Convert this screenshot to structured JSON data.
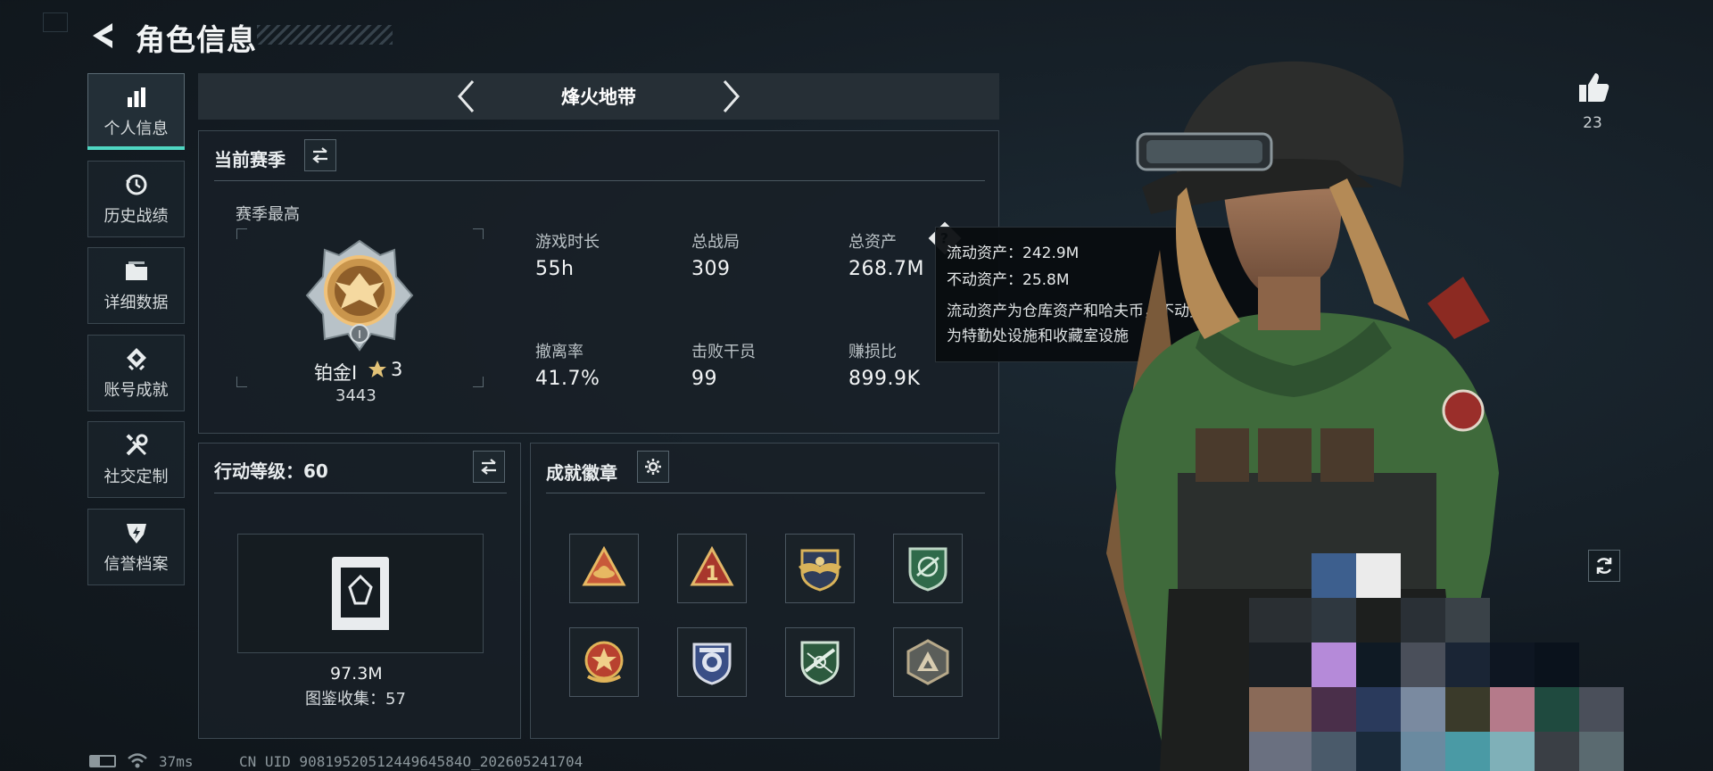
{
  "header": {
    "title": "角色信息"
  },
  "sidebar": {
    "items": [
      {
        "label": "个人信息",
        "icon": "bar-chart-icon",
        "active": true
      },
      {
        "label": "历史战绩",
        "icon": "clock-history-icon",
        "active": false
      },
      {
        "label": "详细数据",
        "icon": "folder-icon",
        "active": false
      },
      {
        "label": "账号成就",
        "icon": "medal-icon",
        "active": false
      },
      {
        "label": "社交定制",
        "icon": "tools-icon",
        "active": false
      },
      {
        "label": "信誉档案",
        "icon": "shield-icon",
        "active": false
      }
    ]
  },
  "season": {
    "name": "烽火地带"
  },
  "current_season": {
    "title": "当前赛季",
    "highest_label": "赛季最高",
    "rank_name": "铂金I",
    "rank_stars": "3",
    "rank_score": "3443",
    "stats": [
      {
        "label": "游戏时长",
        "value": "55h"
      },
      {
        "label": "总战局",
        "value": "309"
      },
      {
        "label": "总资产",
        "value": "268.7M"
      },
      {
        "label": "撤离率",
        "value": "41.7%"
      },
      {
        "label": "击败干员",
        "value": "99"
      },
      {
        "label": "赚损比",
        "value": "899.9K"
      }
    ]
  },
  "tooltip": {
    "liquid": "流动资产：242.9M",
    "fixed": "不动资产：25.8M",
    "desc_line1": "流动资产为仓库资产和哈夫币，不动资产",
    "desc_line2": "为特勤处设施和收藏室设施"
  },
  "action_level": {
    "title": "行动等级：60",
    "value": "97.3M",
    "collection": "图鉴收集：57"
  },
  "achievements": {
    "title": "成就徽章",
    "badge_icons": [
      "hat-badge-icon",
      "number-one-badge-icon",
      "gold-wings-badge-icon",
      "green-shield-badge-icon",
      "star-wreath-badge-icon",
      "blue-shield-badge-icon",
      "green-rifle-badge-icon",
      "grey-triangle-badge-icon"
    ]
  },
  "likes": {
    "count": "23"
  },
  "status_bar": {
    "ping": "37ms",
    "uid": "CN UID 9081952051244964584O_202605241704"
  },
  "colors": {
    "accent": "#4fd6c2",
    "panel_bg": "#182027",
    "tooltip_bg": "#080c0f"
  }
}
